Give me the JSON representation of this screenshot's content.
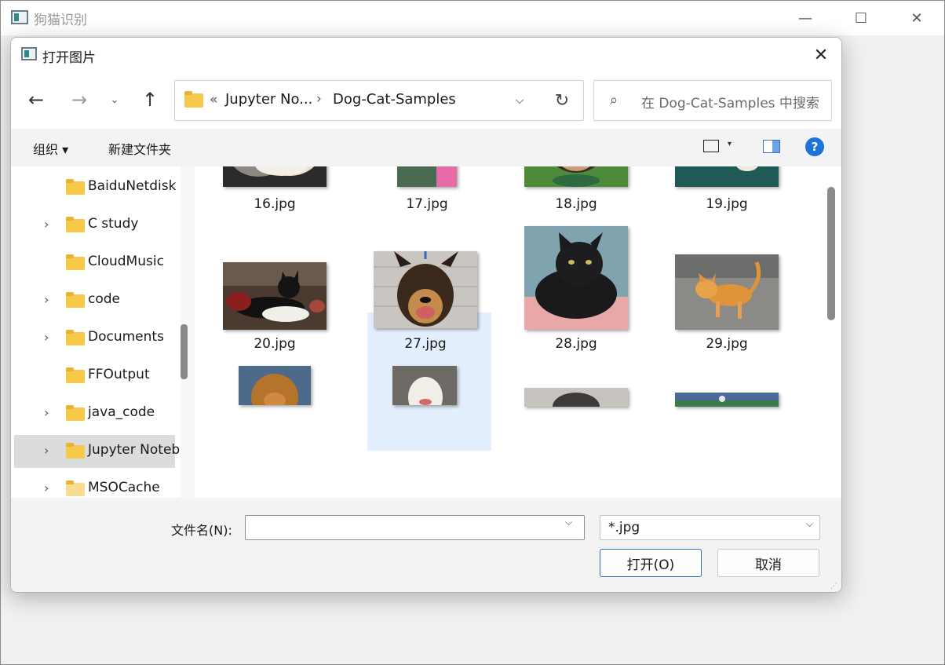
{
  "app": {
    "title": "狗猫识别",
    "minimize_icon": "—",
    "maximize_icon": "☐",
    "close_icon": "✕"
  },
  "dialog": {
    "title": "打开图片",
    "close_icon": "✕"
  },
  "nav": {
    "back_icon": "←",
    "forward_icon": "→",
    "recent_icon": "⌄",
    "up_icon": "↑",
    "address": {
      "overflow": "«",
      "crumbs": [
        "Jupyter No...",
        "Dog-Cat-Samples"
      ],
      "separator": "›",
      "dropdown_icon": "⌵",
      "refresh_icon": "↻"
    },
    "search": {
      "icon": "⌕",
      "placeholder": "在 Dog-Cat-Samples 中搜索"
    }
  },
  "toolbar": {
    "organize": "组织 ▾",
    "new_folder": "新建文件夹",
    "view_arrow": "▾",
    "help": "?"
  },
  "tree": [
    {
      "label": "BaiduNetdisk",
      "expandable": false,
      "selected": false
    },
    {
      "label": "C study",
      "expandable": true,
      "selected": false
    },
    {
      "label": "CloudMusic",
      "expandable": false,
      "selected": false
    },
    {
      "label": "code",
      "expandable": true,
      "selected": false
    },
    {
      "label": "Documents",
      "expandable": true,
      "selected": false
    },
    {
      "label": "FFOutput",
      "expandable": false,
      "selected": false
    },
    {
      "label": "java_code",
      "expandable": true,
      "selected": false
    },
    {
      "label": "Jupyter Notebook",
      "expandable": true,
      "selected": true
    },
    {
      "label": "MSOCache",
      "expandable": true,
      "selected": false
    }
  ],
  "tree_chevron": "›",
  "files": [
    {
      "name": "16.jpg",
      "subject": "cat"
    },
    {
      "name": "17.jpg",
      "subject": "dog"
    },
    {
      "name": "18.jpg",
      "subject": "dog"
    },
    {
      "name": "19.jpg",
      "subject": "cat"
    },
    {
      "name": "20.jpg",
      "subject": "cat"
    },
    {
      "name": "27.jpg",
      "subject": "dog",
      "selected": true
    },
    {
      "name": "28.jpg",
      "subject": "cat"
    },
    {
      "name": "29.jpg",
      "subject": "cat"
    },
    {
      "subject": "dog"
    },
    {
      "subject": "dog"
    },
    {
      "subject": "cat"
    },
    {
      "subject": "unknown"
    }
  ],
  "bottom": {
    "filename_label": "文件名(N):",
    "filename_value": "",
    "dropdown_icon": "⌵",
    "filetype_value": "*.jpg",
    "open_button": "打开(O)",
    "cancel_button": "取消"
  }
}
